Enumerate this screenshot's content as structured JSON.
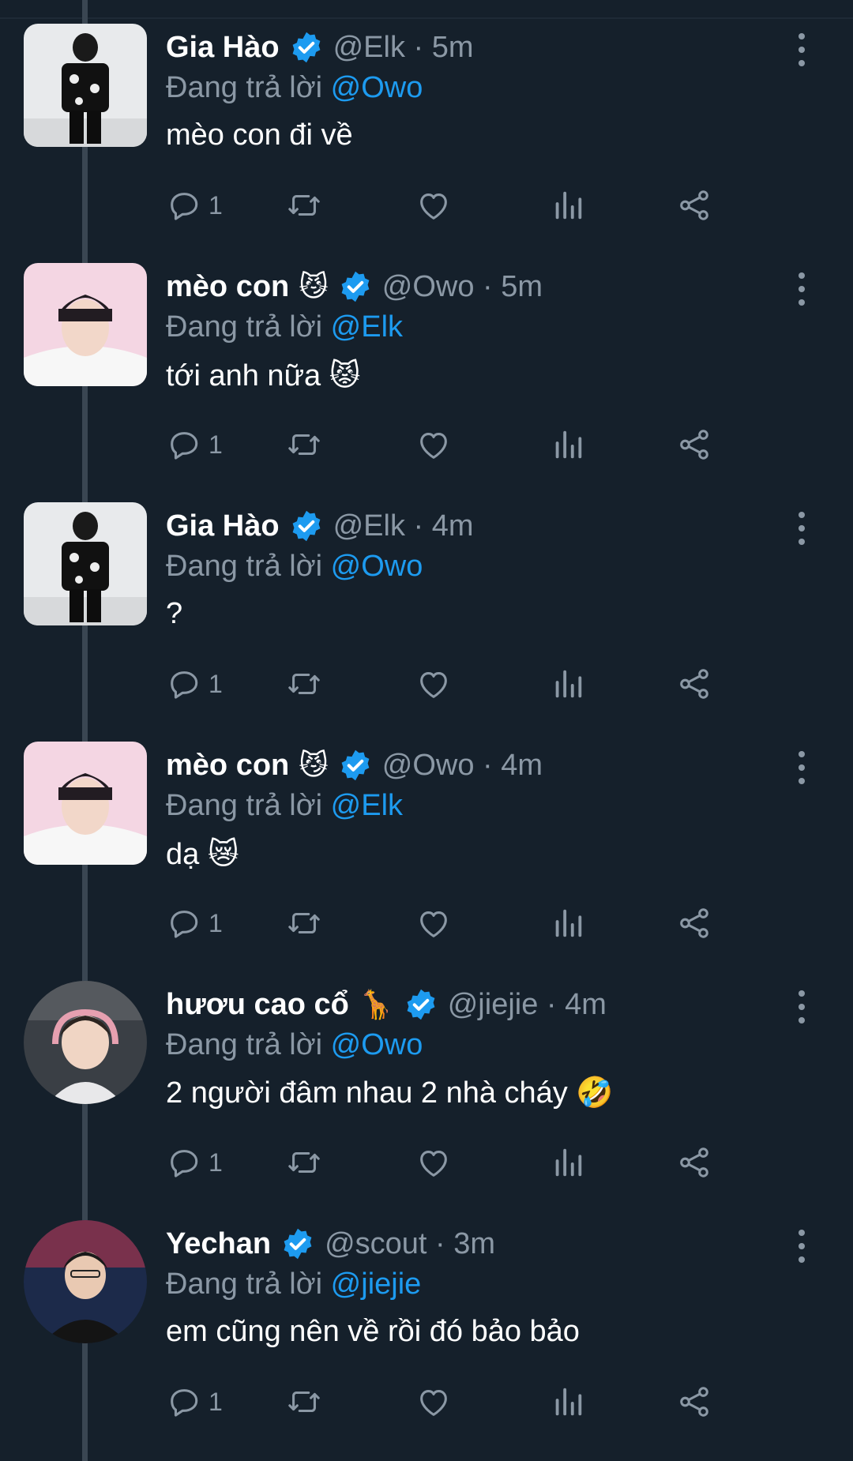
{
  "reply_prefix": "Đang trả lời ",
  "tweets": [
    {
      "name": "Gia Hào",
      "name_emoji": "",
      "handle": "@Elk · 5m",
      "reply_to": "@Owo",
      "text": "mèo con đi về",
      "reply_count": "1",
      "avatar": "man-in-floral-shirt"
    },
    {
      "name": "mèo con",
      "name_emoji": "😼",
      "handle": "@Owo · 5m",
      "reply_to": "@Elk",
      "text": "tới anh nữa 😾",
      "reply_count": "1",
      "avatar": "young-man-portrait"
    },
    {
      "name": "Gia Hào",
      "name_emoji": "",
      "handle": "@Elk · 4m",
      "reply_to": "@Owo",
      "text": "?",
      "reply_count": "1",
      "avatar": "man-in-floral-shirt"
    },
    {
      "name": "mèo con",
      "name_emoji": "😼",
      "handle": "@Owo · 4m",
      "reply_to": "@Elk",
      "text": "dạ 😿",
      "reply_count": "1",
      "avatar": "young-man-portrait"
    },
    {
      "name": "hươu cao cổ",
      "name_emoji": "🦒",
      "handle": "@jiejie · 4m",
      "reply_to": "@Owo",
      "text": "2 người đâm nhau 2 nhà cháy 🤣",
      "reply_count": "1",
      "avatar": "gamer-with-headset"
    },
    {
      "name": "Yechan",
      "name_emoji": "",
      "handle": "@scout · 3m",
      "reply_to": "@jiejie",
      "text": "em cũng nên về rồi đó bảo bảo",
      "reply_count": "1",
      "avatar": "player-in-jersey"
    }
  ],
  "colors": {
    "background": "#15202b",
    "accent": "#1d9bf0",
    "muted": "#8b98a5",
    "thread_line": "#3a4652"
  },
  "icons": [
    "reply-icon",
    "retweet-icon",
    "like-icon",
    "views-icon",
    "share-icon",
    "more-icon",
    "verified-badge-icon"
  ]
}
